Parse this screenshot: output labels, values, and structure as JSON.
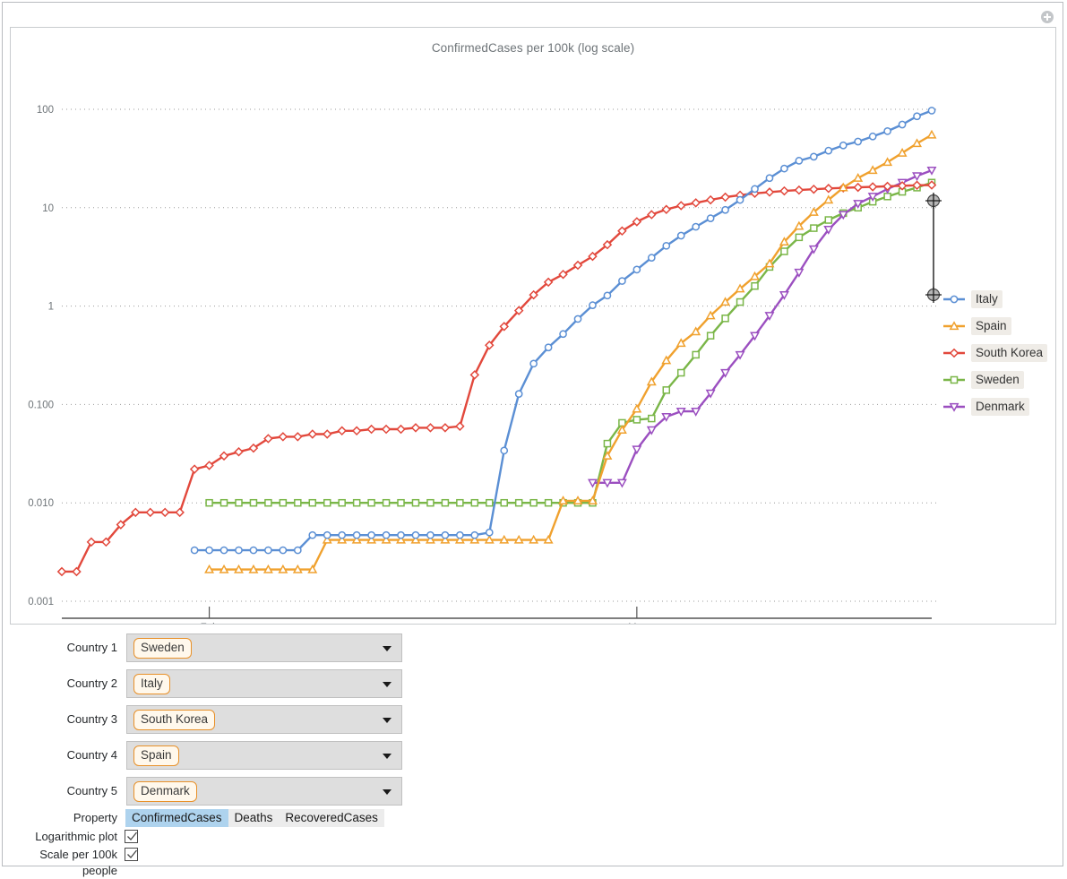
{
  "window": {
    "close_icon": "close-circle-icon"
  },
  "chart": {
    "title": "ConfirmedCases per 100k (log scale)",
    "y_ticks": [
      "100",
      "10",
      "1",
      "0.100",
      "0.010",
      "0.001"
    ],
    "x_ticks": [
      "Feb",
      "Mar"
    ],
    "range_handle": "range-selector-handle"
  },
  "legend": {
    "items": [
      {
        "label": "Italy",
        "color": "#5b8fd4",
        "marker": "circle"
      },
      {
        "label": "Spain",
        "color": "#f0a12e",
        "marker": "triangle-up"
      },
      {
        "label": "South Korea",
        "color": "#e2483c",
        "marker": "diamond"
      },
      {
        "label": "Sweden",
        "color": "#7ab648",
        "marker": "square"
      },
      {
        "label": "Denmark",
        "color": "#9b4fc0",
        "marker": "triangle-down"
      }
    ]
  },
  "controls": {
    "countries": [
      {
        "label": "Country 1",
        "value": "Sweden"
      },
      {
        "label": "Country 2",
        "value": "Italy"
      },
      {
        "label": "Country 3",
        "value": "South Korea"
      },
      {
        "label": "Country 4",
        "value": "Spain"
      },
      {
        "label": "Country 5",
        "value": "Denmark"
      }
    ],
    "property": {
      "label": "Property",
      "options": [
        "ConfirmedCases",
        "Deaths",
        "RecoveredCases"
      ],
      "selected": "ConfirmedCases"
    },
    "checkboxes": [
      {
        "label": "Logarithmic plot",
        "checked": true
      },
      {
        "label": "Scale per 100k people",
        "checked": true
      }
    ]
  },
  "chart_data": {
    "type": "line",
    "title": "ConfirmedCases per 100k (log scale)",
    "xlabel": "",
    "ylabel": "ConfirmedCases per 100k",
    "yscale": "log",
    "ylim": [
      0.001,
      100
    ],
    "y_tick_values": [
      100,
      10,
      1,
      0.1,
      0.01,
      0.001
    ],
    "y_tick_labels": [
      "100",
      "10",
      "1",
      "0.100",
      "0.010",
      "0.001"
    ],
    "x_tick_labels": [
      "Feb",
      "Mar"
    ],
    "x_tick_dates": [
      "2020-02-01",
      "2020-03-01"
    ],
    "x_range": [
      "2020-01-22",
      "2020-03-22"
    ],
    "grid": true,
    "legend_position": "right",
    "series": [
      {
        "name": "Italy",
        "color": "#5b8fd4",
        "marker": "circle",
        "x": [
          "2020-01-31",
          "2020-02-01",
          "2020-02-02",
          "2020-02-03",
          "2020-02-04",
          "2020-02-05",
          "2020-02-06",
          "2020-02-07",
          "2020-02-08",
          "2020-02-09",
          "2020-02-10",
          "2020-02-11",
          "2020-02-12",
          "2020-02-13",
          "2020-02-14",
          "2020-02-15",
          "2020-02-16",
          "2020-02-17",
          "2020-02-18",
          "2020-02-19",
          "2020-02-20",
          "2020-02-21",
          "2020-02-22",
          "2020-02-23",
          "2020-02-24",
          "2020-02-25",
          "2020-02-26",
          "2020-02-27",
          "2020-02-28",
          "2020-02-29",
          "2020-03-01",
          "2020-03-02",
          "2020-03-03",
          "2020-03-04",
          "2020-03-05",
          "2020-03-06",
          "2020-03-07",
          "2020-03-08",
          "2020-03-09",
          "2020-03-10",
          "2020-03-11",
          "2020-03-12",
          "2020-03-13",
          "2020-03-14",
          "2020-03-15",
          "2020-03-16",
          "2020-03-17",
          "2020-03-18",
          "2020-03-19",
          "2020-03-20",
          "2020-03-21"
        ],
        "y": [
          0.0033,
          0.0033,
          0.0033,
          0.0033,
          0.0033,
          0.0033,
          0.0033,
          0.0033,
          0.0047,
          0.0047,
          0.0047,
          0.0047,
          0.0047,
          0.0047,
          0.0047,
          0.0047,
          0.0047,
          0.0047,
          0.0047,
          0.0047,
          0.005,
          0.034,
          0.128,
          0.26,
          0.38,
          0.52,
          0.74,
          1.02,
          1.28,
          1.8,
          2.35,
          3.1,
          4.1,
          5.2,
          6.4,
          7.8,
          9.5,
          12.0,
          15.5,
          20.0,
          25.0,
          30.0,
          33.0,
          38.0,
          43.0,
          47.0,
          53.0,
          60.0,
          70.0,
          85.0,
          97.0
        ]
      },
      {
        "name": "Spain",
        "color": "#f0a12e",
        "marker": "triangle-up",
        "x": [
          "2020-02-01",
          "2020-02-02",
          "2020-02-03",
          "2020-02-04",
          "2020-02-05",
          "2020-02-06",
          "2020-02-07",
          "2020-02-08",
          "2020-02-09",
          "2020-02-10",
          "2020-02-11",
          "2020-02-12",
          "2020-02-13",
          "2020-02-14",
          "2020-02-15",
          "2020-02-16",
          "2020-02-17",
          "2020-02-18",
          "2020-02-19",
          "2020-02-20",
          "2020-02-21",
          "2020-02-22",
          "2020-02-23",
          "2020-02-24",
          "2020-02-25",
          "2020-02-26",
          "2020-02-27",
          "2020-02-28",
          "2020-02-29",
          "2020-03-01",
          "2020-03-02",
          "2020-03-03",
          "2020-03-04",
          "2020-03-05",
          "2020-03-06",
          "2020-03-07",
          "2020-03-08",
          "2020-03-09",
          "2020-03-10",
          "2020-03-11",
          "2020-03-12",
          "2020-03-13",
          "2020-03-14",
          "2020-03-15",
          "2020-03-16",
          "2020-03-17",
          "2020-03-18",
          "2020-03-19",
          "2020-03-20",
          "2020-03-21"
        ],
        "y": [
          0.0021,
          0.0021,
          0.0021,
          0.0021,
          0.0021,
          0.0021,
          0.0021,
          0.0021,
          0.0042,
          0.0042,
          0.0042,
          0.0042,
          0.0042,
          0.0042,
          0.0042,
          0.0042,
          0.0042,
          0.0042,
          0.0042,
          0.0042,
          0.0042,
          0.0042,
          0.0042,
          0.0042,
          0.0105,
          0.0105,
          0.0105,
          0.03,
          0.055,
          0.09,
          0.17,
          0.28,
          0.42,
          0.55,
          0.8,
          1.1,
          1.5,
          2.0,
          2.7,
          4.5,
          6.5,
          9.0,
          12.0,
          16.0,
          20.0,
          24.0,
          29.0,
          36.0,
          45.0,
          55.0
        ]
      },
      {
        "name": "South Korea",
        "color": "#e2483c",
        "marker": "diamond",
        "x": [
          "2020-01-22",
          "2020-01-23",
          "2020-01-24",
          "2020-01-25",
          "2020-01-26",
          "2020-01-27",
          "2020-01-28",
          "2020-01-29",
          "2020-01-30",
          "2020-01-31",
          "2020-02-01",
          "2020-02-02",
          "2020-02-03",
          "2020-02-04",
          "2020-02-05",
          "2020-02-06",
          "2020-02-07",
          "2020-02-08",
          "2020-02-09",
          "2020-02-10",
          "2020-02-11",
          "2020-02-12",
          "2020-02-13",
          "2020-02-14",
          "2020-02-15",
          "2020-02-16",
          "2020-02-17",
          "2020-02-18",
          "2020-02-19",
          "2020-02-20",
          "2020-02-21",
          "2020-02-22",
          "2020-02-23",
          "2020-02-24",
          "2020-02-25",
          "2020-02-26",
          "2020-02-27",
          "2020-02-28",
          "2020-02-29",
          "2020-03-01",
          "2020-03-02",
          "2020-03-03",
          "2020-03-04",
          "2020-03-05",
          "2020-03-06",
          "2020-03-07",
          "2020-03-08",
          "2020-03-09",
          "2020-03-10",
          "2020-03-11",
          "2020-03-12",
          "2020-03-13",
          "2020-03-14",
          "2020-03-15",
          "2020-03-16",
          "2020-03-17",
          "2020-03-18",
          "2020-03-19",
          "2020-03-20",
          "2020-03-21"
        ],
        "y": [
          0.002,
          0.002,
          0.004,
          0.004,
          0.006,
          0.008,
          0.008,
          0.008,
          0.008,
          0.022,
          0.024,
          0.03,
          0.033,
          0.036,
          0.045,
          0.047,
          0.047,
          0.05,
          0.05,
          0.054,
          0.054,
          0.056,
          0.056,
          0.056,
          0.058,
          0.058,
          0.058,
          0.06,
          0.2,
          0.4,
          0.62,
          0.9,
          1.3,
          1.75,
          2.1,
          2.6,
          3.2,
          4.2,
          5.8,
          7.2,
          8.5,
          9.6,
          10.5,
          11.2,
          12.0,
          12.8,
          13.4,
          14.0,
          14.4,
          14.8,
          15.1,
          15.4,
          15.7,
          15.9,
          16.1,
          16.3,
          16.5,
          16.7,
          16.9,
          17.0
        ]
      },
      {
        "name": "Sweden",
        "color": "#7ab648",
        "marker": "square",
        "x": [
          "2020-02-01",
          "2020-02-02",
          "2020-02-03",
          "2020-02-04",
          "2020-02-05",
          "2020-02-06",
          "2020-02-07",
          "2020-02-08",
          "2020-02-09",
          "2020-02-10",
          "2020-02-11",
          "2020-02-12",
          "2020-02-13",
          "2020-02-14",
          "2020-02-15",
          "2020-02-16",
          "2020-02-17",
          "2020-02-18",
          "2020-02-19",
          "2020-02-20",
          "2020-02-21",
          "2020-02-22",
          "2020-02-23",
          "2020-02-24",
          "2020-02-25",
          "2020-02-26",
          "2020-02-27",
          "2020-02-28",
          "2020-02-29",
          "2020-03-01",
          "2020-03-02",
          "2020-03-03",
          "2020-03-04",
          "2020-03-05",
          "2020-03-06",
          "2020-03-07",
          "2020-03-08",
          "2020-03-09",
          "2020-03-10",
          "2020-03-11",
          "2020-03-12",
          "2020-03-13",
          "2020-03-14",
          "2020-03-15",
          "2020-03-16",
          "2020-03-17",
          "2020-03-18",
          "2020-03-19",
          "2020-03-20",
          "2020-03-21"
        ],
        "y": [
          0.01,
          0.01,
          0.01,
          0.01,
          0.01,
          0.01,
          0.01,
          0.01,
          0.01,
          0.01,
          0.01,
          0.01,
          0.01,
          0.01,
          0.01,
          0.01,
          0.01,
          0.01,
          0.01,
          0.01,
          0.01,
          0.01,
          0.01,
          0.01,
          0.01,
          0.01,
          0.01,
          0.04,
          0.065,
          0.07,
          0.072,
          0.14,
          0.21,
          0.32,
          0.5,
          0.75,
          1.1,
          1.6,
          2.5,
          3.6,
          5.0,
          6.2,
          7.5,
          8.8,
          10.0,
          11.5,
          13.0,
          14.5,
          16.0,
          18.0
        ]
      },
      {
        "name": "Denmark",
        "color": "#9b4fc0",
        "marker": "triangle-down",
        "x": [
          "2020-02-27",
          "2020-02-28",
          "2020-02-29",
          "2020-03-01",
          "2020-03-02",
          "2020-03-03",
          "2020-03-04",
          "2020-03-05",
          "2020-03-06",
          "2020-03-07",
          "2020-03-08",
          "2020-03-09",
          "2020-03-10",
          "2020-03-11",
          "2020-03-12",
          "2020-03-13",
          "2020-03-14",
          "2020-03-15",
          "2020-03-16",
          "2020-03-17",
          "2020-03-18",
          "2020-03-19",
          "2020-03-20",
          "2020-03-21"
        ],
        "y": [
          0.016,
          0.016,
          0.016,
          0.035,
          0.055,
          0.075,
          0.085,
          0.085,
          0.13,
          0.21,
          0.32,
          0.5,
          0.8,
          1.3,
          2.2,
          3.8,
          6.0,
          8.5,
          11.0,
          13.0,
          15.5,
          18.0,
          21.0,
          24.0
        ]
      }
    ]
  }
}
